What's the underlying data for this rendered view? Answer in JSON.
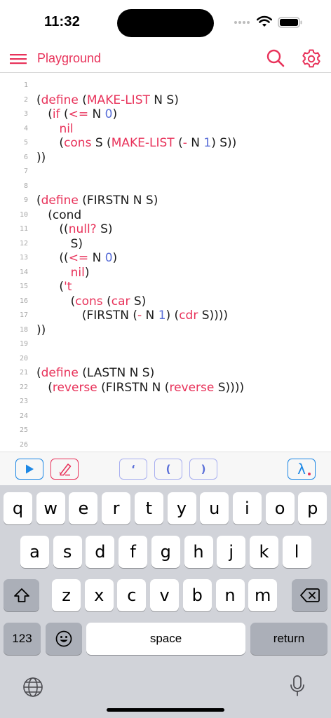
{
  "status": {
    "time": "11:32"
  },
  "nav": {
    "title": "Playground",
    "menu_icon": "hamburger-menu-icon",
    "search_icon": "search-icon",
    "settings_icon": "gear-icon",
    "accent": "#e8325a"
  },
  "editor": {
    "lines": [
      {
        "num": "1",
        "code": ""
      },
      {
        "num": "2",
        "code": "(define (MAKE-LIST N S)"
      },
      {
        "num": "3",
        "code": "   (if (<= N 0)"
      },
      {
        "num": "4",
        "code": "      nil"
      },
      {
        "num": "5",
        "code": "      (cons S (MAKE-LIST (- N 1) S))"
      },
      {
        "num": "6",
        "code": "))"
      },
      {
        "num": "7",
        "code": ""
      },
      {
        "num": "8",
        "code": ""
      },
      {
        "num": "9",
        "code": "(define (FIRSTN N S)"
      },
      {
        "num": "10",
        "code": "   (cond"
      },
      {
        "num": "11",
        "code": "      ((null? S)"
      },
      {
        "num": "12",
        "code": "         S)"
      },
      {
        "num": "13",
        "code": "      ((<= N 0)"
      },
      {
        "num": "14",
        "code": "         nil)"
      },
      {
        "num": "15",
        "code": "      ('t"
      },
      {
        "num": "16",
        "code": "         (cons (car S)"
      },
      {
        "num": "17",
        "code": "            (FIRSTN (- N 1) (cdr S))))"
      },
      {
        "num": "18",
        "code": "))"
      },
      {
        "num": "19",
        "code": ""
      },
      {
        "num": "20",
        "code": ""
      },
      {
        "num": "21",
        "code": "(define (LASTN N S)"
      },
      {
        "num": "22",
        "code": "   (reverse (FIRSTN N (reverse S))))"
      },
      {
        "num": "23",
        "code": ""
      },
      {
        "num": "24",
        "code": ""
      },
      {
        "num": "25",
        "code": ""
      },
      {
        "num": "26",
        "code": ""
      }
    ]
  },
  "toolbar": {
    "run_icon": "play-icon",
    "clear_icon": "eraser-icon",
    "quote_label": "‘",
    "open_paren_label": "(",
    "close_paren_label": ")",
    "lambda_label": "λ"
  },
  "keyboard": {
    "row1": [
      "q",
      "w",
      "e",
      "r",
      "t",
      "y",
      "u",
      "i",
      "o",
      "p"
    ],
    "row2": [
      "a",
      "s",
      "d",
      "f",
      "g",
      "h",
      "j",
      "k",
      "l"
    ],
    "row3": [
      "z",
      "x",
      "c",
      "v",
      "b",
      "n",
      "m"
    ],
    "numbers_label": "123",
    "space_label": "space",
    "return_label": "return",
    "shift_icon": "shift-icon",
    "delete_icon": "backspace-icon",
    "emoji_icon": "emoji-icon",
    "globe_icon": "globe-icon",
    "mic_icon": "microphone-icon"
  }
}
